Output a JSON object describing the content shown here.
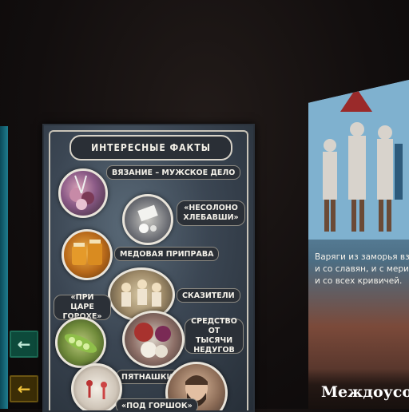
{
  "poster": {
    "title": "ИНТЕРЕСНЫЕ ФАКТЫ",
    "facts": [
      "ВЯЗАНИЕ – МУЖСКОЕ ДЕЛО",
      "«НЕСОЛОНО ХЛЕБАВШИ»",
      "МЕДОВАЯ ПРИПРАВА",
      "СКАЗИТЕЛИ",
      "«ПРИ ЦАРЕ ГОРОХЕ»",
      "СРЕДСТВО ОТ ТЫСЯЧИ НЕДУГОВ",
      "ПЯТНАШКИ",
      "«ПОД ГОРШОК»"
    ]
  },
  "right_poster": {
    "caption_lines": [
      "Варяги из заморья вз",
      "и со славян, и с мери",
      "и со всех кривичей."
    ],
    "title": "Междоусо"
  },
  "exit_signs": {
    "green_arrow": "←",
    "yellow_arrow": "←"
  },
  "colors": {
    "poster_bg": "#3b4653",
    "frame": "#e9e4da",
    "exit_green": "#0d4a3b",
    "exit_yellow": "#f0c33a"
  }
}
